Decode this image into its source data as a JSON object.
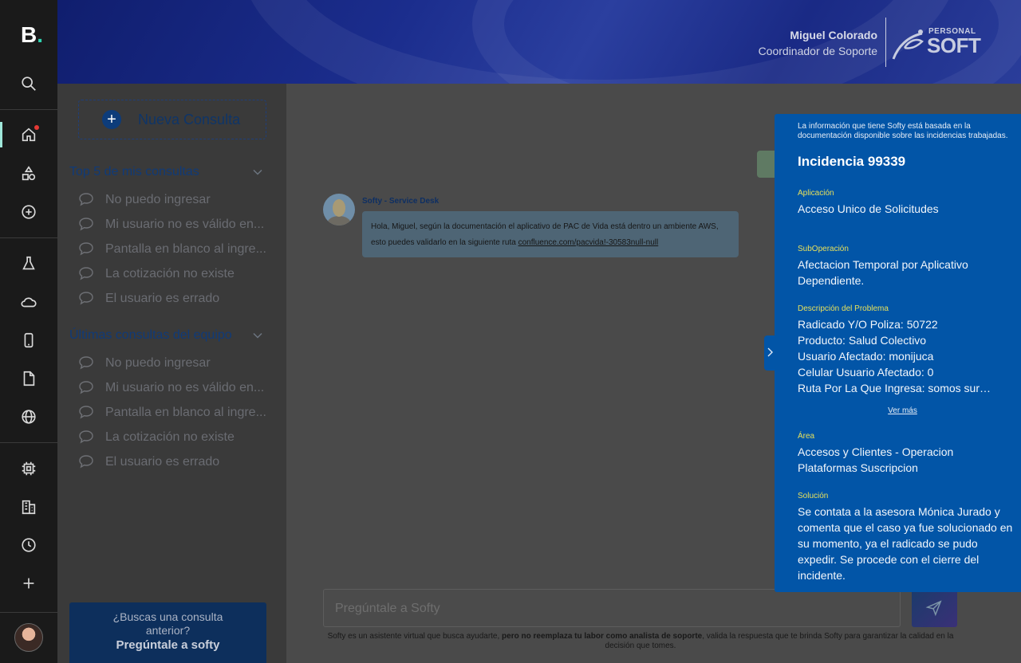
{
  "app": {
    "logo": "B",
    "logo_dot": "."
  },
  "header": {
    "user_name": "Miguel Colorado",
    "user_role": "Coordinador de Soporte",
    "brand_top": "PERSONAL",
    "brand_main": "SOFT"
  },
  "rail": {
    "icons": [
      "search-icon",
      "home-icon",
      "shapes-icon",
      "add-circle-icon",
      "flask-icon",
      "cloud-icon",
      "mobile-icon",
      "document-icon",
      "globe-icon",
      "chip-icon",
      "building-icon",
      "clock-icon",
      "plus-icon"
    ]
  },
  "sidebar": {
    "new_button": "Nueva Consulta",
    "top5_title": "Top 5 de mis consultas",
    "top5": [
      "No puedo ingresar",
      "Mi usuario no es válido en...",
      "Pantalla en blanco al ingre...",
      "La cotización no existe",
      "El usuario es errado"
    ],
    "team_title": "Últimas consultas del equipo",
    "team": [
      "No puedo ingresar",
      "Mi usuario no es válido en...",
      "Pantalla en blanco al ingre...",
      "La cotización no existe",
      "El usuario es errado"
    ],
    "ask_prompt": "¿Buscas una consulta anterior?",
    "ask_action": "Pregúntale a softy"
  },
  "chat": {
    "bot_name": "Softy - Service Desk",
    "message_text": "Hola, Miguel, según la documentación el aplicativo de PAC de Vida está dentro un ambiente AWS, esto puedes validarlo en la siguiente ruta ",
    "message_link": "confluence.com/pacvida!-30583null-null",
    "input_placeholder": "Pregúntale a Softy",
    "disclaimer_a": "Softy es un asistente virtual que busca ayudarte, ",
    "disclaimer_b": "pero no reemplaza tu labor como analista de soporte",
    "disclaimer_c": ", valida la respuesta que te brinda Softy para garantizar la calidad en la decisión que tomes."
  },
  "drawer": {
    "note": "La información que tiene Softy está basada en la documentación disponible sobre las incidencias trabajadas.",
    "title": "Incidencia 99339",
    "app_label": "Aplicación",
    "app_value": "Acceso Unico de Solicitudes",
    "subop_label": "SubOperación",
    "subop_value": "Afectacion Temporal por Aplicativo Dependiente.",
    "desc_label": "Descripción del Problema",
    "desc_lines": [
      "Radicado Y/O Poliza: 50722",
      "Producto: Salud Colectivo",
      "Usuario Afectado: monijuca",
      "Celular Usuario Afectado: 0",
      "Ruta Por La Que Ingresa: somos sura - plataformas"
    ],
    "see_more": "Ver más",
    "area_label": "Área",
    "area_value": "Accesos y Clientes - Operacion Plataformas Suscripcion",
    "solution_label": "Solución",
    "solution_value": "Se contata a la asesora Mónica Jurado  y comenta que el caso ya fue solucionado en su momento, ya el radicado se pudo expedir. Se procede con el cierre del incidente."
  },
  "colors": {
    "drawer_bg": "#0255a7",
    "label_yellow": "#e6e05c",
    "rail_bg": "#1a1a1a",
    "accent_green": "#2fd3b0"
  }
}
